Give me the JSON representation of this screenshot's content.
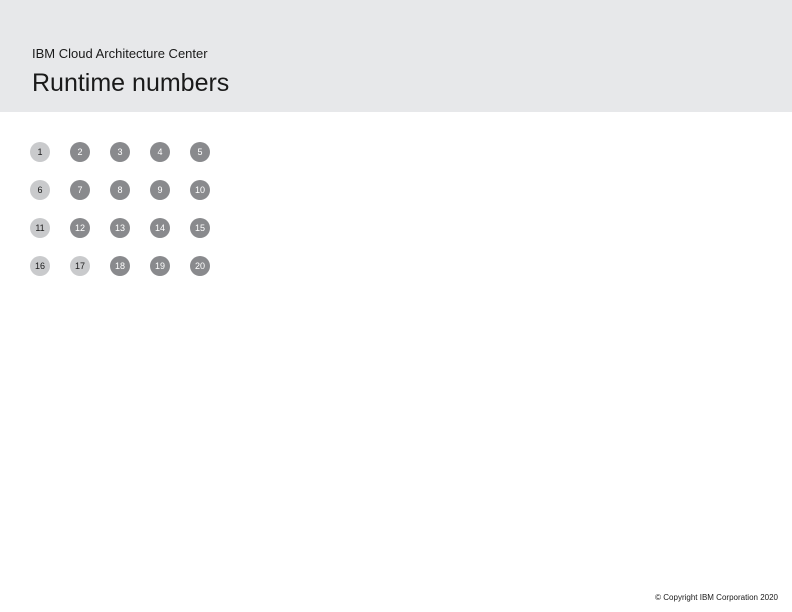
{
  "header": {
    "subtitle": "IBM Cloud Architecture Center",
    "title": "Runtime numbers"
  },
  "grid": {
    "rows": [
      [
        "1",
        "2",
        "3",
        "4",
        "5"
      ],
      [
        "6",
        "7",
        "8",
        "9",
        "10"
      ],
      [
        "11",
        "12",
        "13",
        "14",
        "15"
      ],
      [
        "16",
        "17",
        "18",
        "19",
        "20"
      ]
    ],
    "light_positions": [
      [
        0,
        0
      ],
      [
        1,
        0
      ],
      [
        2,
        0
      ],
      [
        3,
        0
      ],
      [
        3,
        1
      ]
    ]
  },
  "footer": {
    "copyright": "© Copyright IBM Corporation 2020"
  }
}
